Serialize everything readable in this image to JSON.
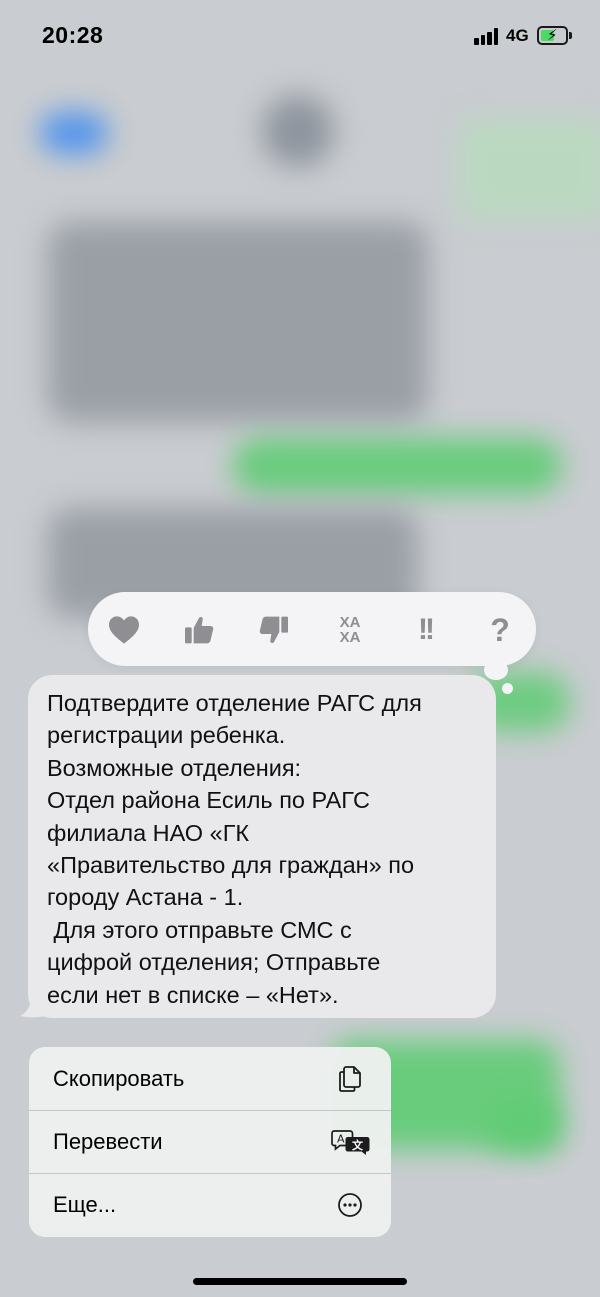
{
  "status_bar": {
    "time": "20:28",
    "network": "4G"
  },
  "tapbacks": [
    {
      "name": "heart",
      "icon": "heart-icon"
    },
    {
      "name": "thumbs-up",
      "icon": "thumbs-up-icon"
    },
    {
      "name": "thumbs-down",
      "icon": "thumbs-down-icon"
    },
    {
      "name": "haha",
      "icon": "haha-icon",
      "label_top": "ХА",
      "label_bottom": "ХА"
    },
    {
      "name": "emphasize",
      "icon": "double-exclamation-icon",
      "label": "!!"
    },
    {
      "name": "question",
      "icon": "question-icon",
      "label": "?"
    }
  ],
  "message": {
    "lines": [
      "Подтвердите отделение РАГС для",
      "регистрации ребенка.",
      "Возможные отделения:",
      "Отдел района Есиль по РАГС",
      "филиала НАО «ГК",
      "«Правительство для граждан» по",
      "городу Астана - 1.",
      " Для этого отправьте СМС с",
      "цифрой отделения; Отправьте",
      "если нет в списке – «Нет»."
    ]
  },
  "context_menu": {
    "items": [
      {
        "label": "Скопировать",
        "icon": "copy-icon"
      },
      {
        "label": "Перевести",
        "icon": "translate-icon"
      },
      {
        "label": "Еще...",
        "icon": "more-icon"
      }
    ]
  },
  "colors": {
    "bubble": "#e9e9eb",
    "tapback_bar": "#f4f4f6",
    "tapback_icon": "#8e8e93",
    "battery_fill": "#4cd964",
    "green_bubble": "#5fcc74"
  }
}
